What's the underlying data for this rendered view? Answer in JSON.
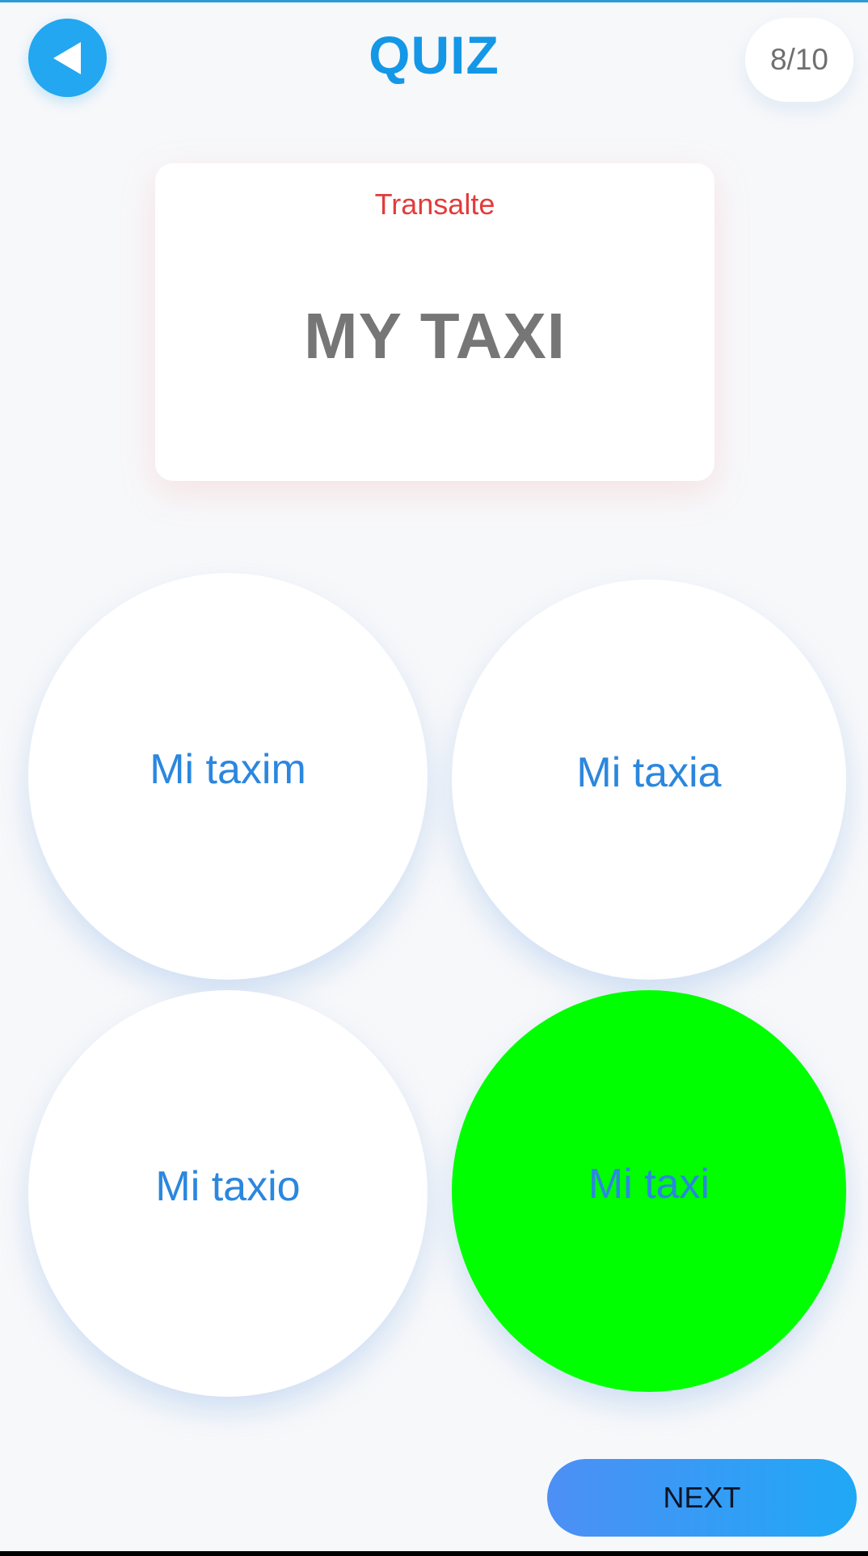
{
  "header": {
    "title": "QUIZ",
    "progress": "8/10",
    "back_icon": "back-arrow-icon"
  },
  "card": {
    "label": "Transalte",
    "word": "MY TAXI"
  },
  "options": [
    {
      "label": "Mi taxim",
      "state": "default"
    },
    {
      "label": "Mi taxia",
      "state": "default"
    },
    {
      "label": "Mi taxio",
      "state": "default"
    },
    {
      "label": "Mi taxi",
      "state": "correct"
    }
  ],
  "footer": {
    "next_label": "NEXT"
  },
  "colors": {
    "accent": "#1497e6",
    "back_button": "#22a7f0",
    "label_red": "#e23b3b",
    "correct_green": "#00ff00",
    "option_text": "#2b87de"
  }
}
